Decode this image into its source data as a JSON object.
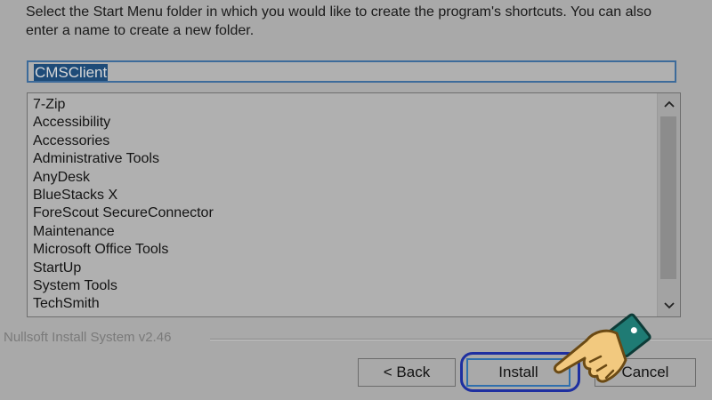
{
  "dialog": {
    "instructions": "Select the Start Menu folder in which you would like to create the program's shortcuts. You can also enter a name to create a new folder.",
    "folder_input_value": "CMSClient",
    "folders": [
      "7-Zip",
      "Accessibility",
      "Accessories",
      "Administrative Tools",
      "AnyDesk",
      "BlueStacks X",
      "ForeScout SecureConnector",
      "Maintenance",
      "Microsoft Office Tools",
      "StartUp",
      "System Tools",
      "TechSmith"
    ],
    "branding": "Nullsoft Install System v2.46",
    "buttons": {
      "back": "< Back",
      "install": "Install",
      "cancel": "Cancel"
    }
  },
  "icons": {
    "scroll_up": "chevron-up-icon",
    "scroll_down": "chevron-down-icon",
    "pointer": "pointing-hand-icon"
  },
  "colors": {
    "highlight_ring": "#1e2fa0",
    "selection": "#1e4b78",
    "hand_skin": "#f2c97f",
    "hand_cuff": "#1f7b74"
  }
}
